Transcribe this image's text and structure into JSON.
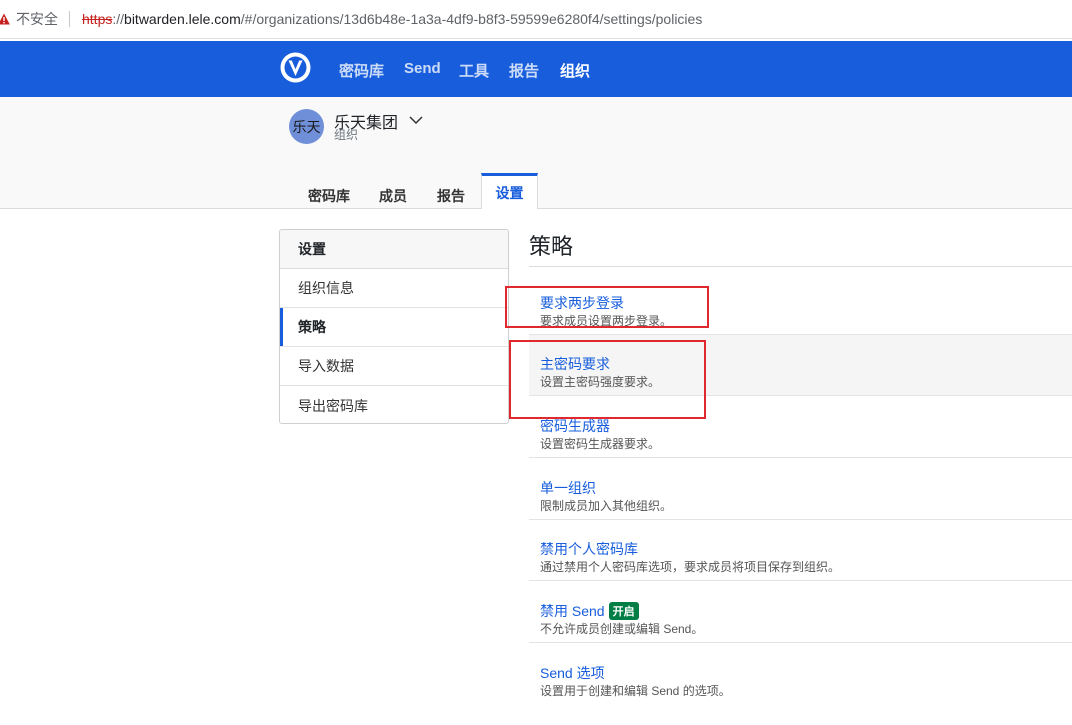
{
  "browser": {
    "insecure_label": "不安全",
    "url_scheme": "https",
    "url_sep": "://",
    "url_host": "bitwarden.lele.com",
    "url_path": "/#/organizations/13d6b48e-1a3a-4df9-b8f3-59599e6280f4/settings/policies"
  },
  "nav": {
    "items": [
      {
        "label": "密码库"
      },
      {
        "label": "Send"
      },
      {
        "label": "工具"
      },
      {
        "label": "报告"
      },
      {
        "label": "组织"
      }
    ],
    "active": "组织",
    "color": "#175ddc"
  },
  "org": {
    "avatar_text": "乐天",
    "name": "乐天集团",
    "subtitle": "组织",
    "tabs": [
      {
        "label": "密码库"
      },
      {
        "label": "成员"
      },
      {
        "label": "报告"
      },
      {
        "label": "设置"
      }
    ],
    "active_tab": "设置"
  },
  "sidebar": {
    "heading": "设置",
    "items": [
      {
        "label": "组织信息"
      },
      {
        "label": "策略"
      },
      {
        "label": "导入数据"
      },
      {
        "label": "导出密码库"
      }
    ],
    "active": "策略"
  },
  "main": {
    "title": "策略",
    "policies": [
      {
        "name": "要求两步登录",
        "desc": "要求成员设置两步登录。"
      },
      {
        "name": "主密码要求",
        "desc": "设置主密码强度要求。"
      },
      {
        "name": "密码生成器",
        "desc": "设置密码生成器要求。"
      },
      {
        "name": "单一组织",
        "desc": "限制成员加入其他组织。"
      },
      {
        "name": "禁用个人密码库",
        "desc": "通过禁用个人密码库选项，要求成员将项目保存到组织。"
      },
      {
        "name": "禁用 Send",
        "desc": "不允许成员创建或编辑 Send。",
        "badge": "开启"
      },
      {
        "name": "Send 选项",
        "desc": "设置用于创建和编辑 Send 的选项。"
      }
    ]
  }
}
